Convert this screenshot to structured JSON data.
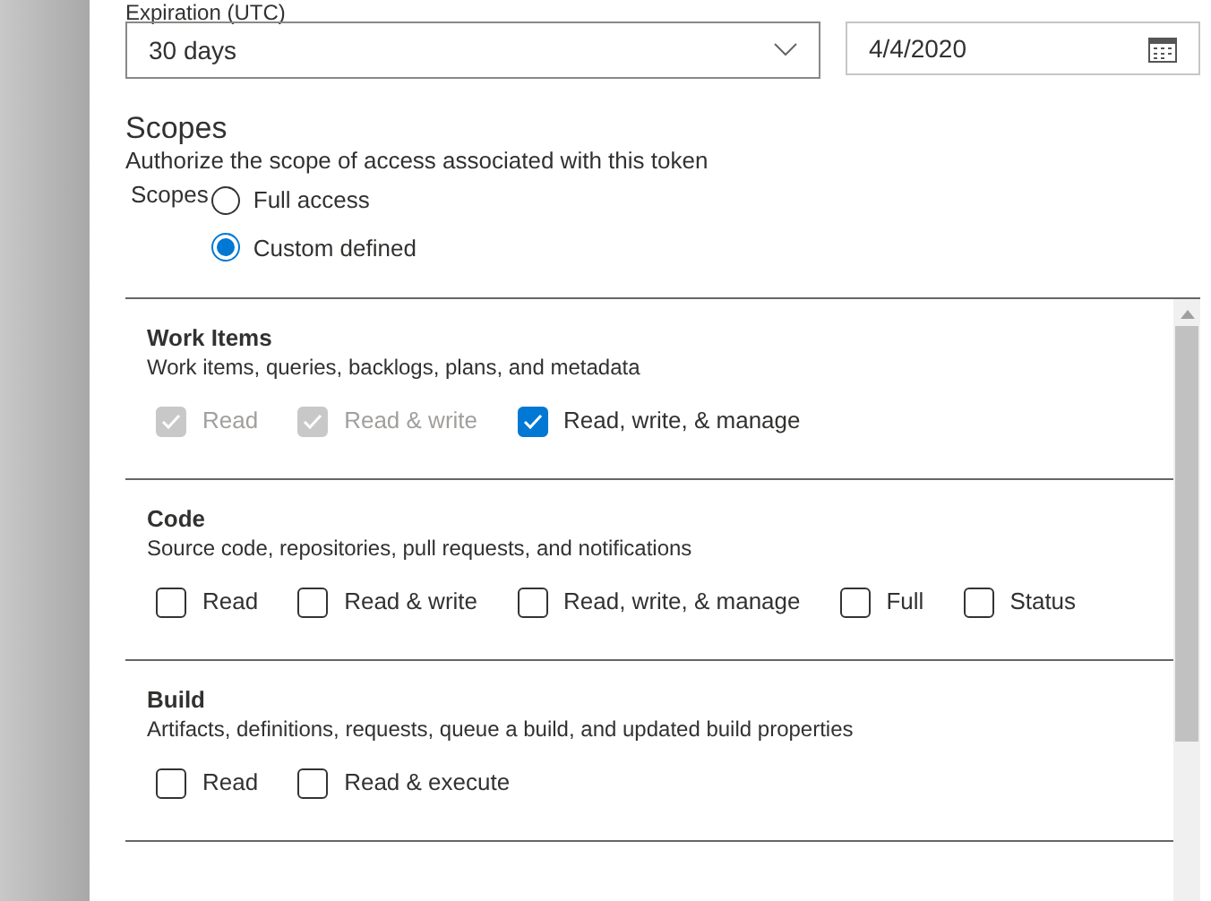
{
  "expiration": {
    "label": "Expiration (UTC)",
    "duration": "30 days",
    "date": "4/4/2020"
  },
  "scopes": {
    "title": "Scopes",
    "description": "Authorize the scope of access associated with this token",
    "group_label": "Scopes",
    "options": [
      {
        "label": "Full access",
        "selected": false
      },
      {
        "label": "Custom defined",
        "selected": true
      }
    ]
  },
  "sections": [
    {
      "title": "Work Items",
      "description": "Work items, queries, backlogs, plans, and metadata",
      "options": [
        {
          "label": "Read",
          "checked": true,
          "disabled": true
        },
        {
          "label": "Read & write",
          "checked": true,
          "disabled": true
        },
        {
          "label": "Read, write, & manage",
          "checked": true,
          "disabled": false
        }
      ]
    },
    {
      "title": "Code",
      "description": "Source code, repositories, pull requests, and notifications",
      "options": [
        {
          "label": "Read",
          "checked": false,
          "disabled": false
        },
        {
          "label": "Read & write",
          "checked": false,
          "disabled": false
        },
        {
          "label": "Read, write, & manage",
          "checked": false,
          "disabled": false
        },
        {
          "label": "Full",
          "checked": false,
          "disabled": false
        },
        {
          "label": "Status",
          "checked": false,
          "disabled": false
        }
      ]
    },
    {
      "title": "Build",
      "description": "Artifacts, definitions, requests, queue a build, and updated build properties",
      "options": [
        {
          "label": "Read",
          "checked": false,
          "disabled": false
        },
        {
          "label": "Read & execute",
          "checked": false,
          "disabled": false
        }
      ]
    }
  ]
}
